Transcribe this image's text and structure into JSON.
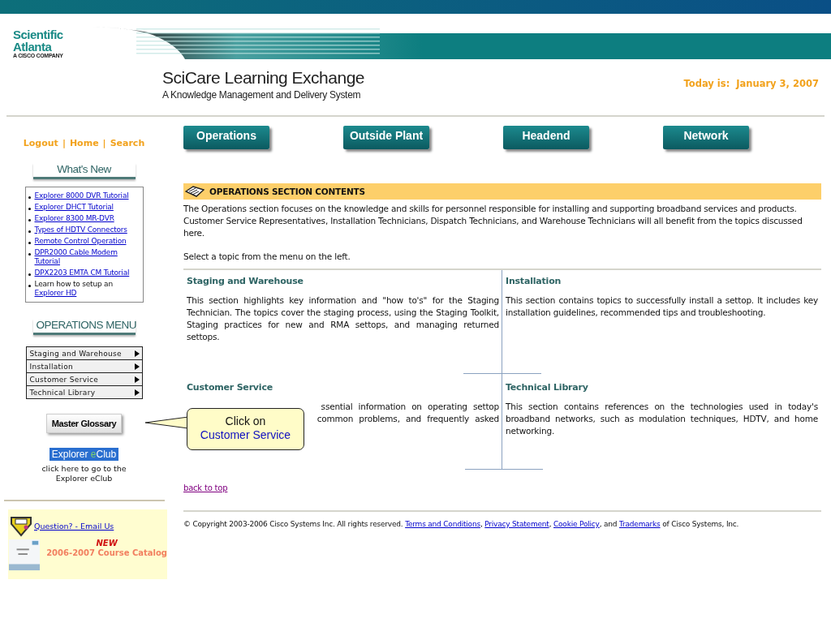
{
  "header": {
    "logo_name": "Scientific Atlanta",
    "logo_tagline": "A CISCO COMPANY",
    "title": "SciCare Learning Exchange",
    "subtitle": "A Knowledge Management and Delivery System",
    "date_label": "Today is:",
    "date": "January 3, 2007"
  },
  "user_links": [
    "Logout",
    "Home",
    "Search"
  ],
  "user_links_separator": "|",
  "nav_buttons": [
    "Operations",
    "Outside Plant",
    "Headend",
    "Network"
  ],
  "whats_new": {
    "heading": "What's New",
    "items": [
      {
        "link": "Explorer 8000 DVR Tutorial"
      },
      {
        "link": "Explorer DHCT Tutorial"
      },
      {
        "link": "Explorer 8300 MR-DVR"
      },
      {
        "link": "Types of HDTV Connectors"
      },
      {
        "link": "Remote Control Operation"
      },
      {
        "link": "DPR2000 Cable Modem Tutorial"
      },
      {
        "link": "DPX2203 EMTA CM Tutorial"
      },
      {
        "text": "Learn how to setup an",
        "link": "Explorer HD"
      }
    ]
  },
  "operations_menu": {
    "heading": "OPERATIONS MENU",
    "items": [
      "Staging and Warehouse",
      "Installation",
      "Customer Service",
      "Technical Library"
    ]
  },
  "glossary_button": "Master Glossary",
  "eclub": {
    "label_parts": [
      "Explorer ",
      "e",
      "Club"
    ],
    "caption": "click here to go to the Explorer eClub"
  },
  "contact": {
    "link": "Question? - Email Us",
    "badge": "NEW",
    "catalog": "2006-2007 Course Catalog"
  },
  "contents": {
    "heading": "OPERATIONS SECTION CONTENTS",
    "intro": "The Operations section focuses on the knowledge and skills for personnel responsible for installing and supporting broadband services and products. Customer Service Representatives, Installation Technicians, Dispatch Technicians, and Warehouse Technicians will all benefit from the topics discussed here.",
    "instruction": "Select a topic from the menu on the left."
  },
  "sections": [
    {
      "title": "Staging and Warehouse",
      "lines": [
        "This section highlights key information and \"how to's\" for the Staging Technician. The topics cover the staging process, using the Staging Toolkit, Staging practices for new and RMA settops, and managing returned settops."
      ]
    },
    {
      "title": "Installation",
      "lines": [
        "This section contains topics to successfully install a settop. It includes key installation guidelines, recommended tips and troubleshooting."
      ]
    },
    {
      "title": "Customer Service",
      "lines": [
        "ssential information on operating settop",
        "common problems, and frequently asked"
      ]
    },
    {
      "title": "Technical Library",
      "lines": [
        "This section contains references on the technologies used in today's broadband networks, such as modulation techniques, HDTV, and home networking."
      ]
    }
  ],
  "callout": {
    "text": "Click on",
    "link": "Customer Service"
  },
  "back_to_top": "back to top",
  "footer": [
    {
      "kind": "text",
      "text": "© Copyright 2003-2006 Cisco Systems Inc. All rights reserved. "
    },
    {
      "kind": "link",
      "text": "Terms and Conditions"
    },
    {
      "kind": "text",
      "text": ", "
    },
    {
      "kind": "link",
      "text": "Privacy Statement"
    },
    {
      "kind": "text",
      "text": ", "
    },
    {
      "kind": "link",
      "text": "Cookie Policy"
    },
    {
      "kind": "text",
      "text": ", and "
    },
    {
      "kind": "link",
      "text": "Trademarks"
    },
    {
      "kind": "text",
      "text": " of Cisco Systems, Inc."
    }
  ]
}
